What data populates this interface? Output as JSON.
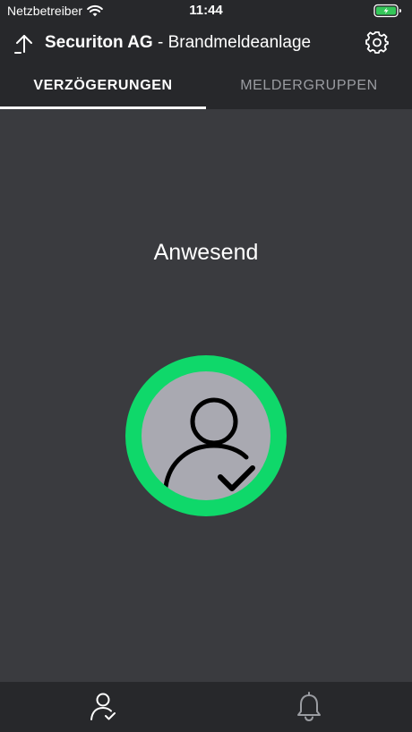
{
  "status_bar": {
    "carrier": "Netzbetreiber",
    "time": "11:44",
    "battery_color": "#34c759"
  },
  "navbar": {
    "company": "Securiton AG",
    "separator": " - ",
    "system": "Brandmeldeanlage",
    "up_icon": "arrow-up-icon",
    "settings_icon": "gear-icon"
  },
  "tabs": [
    {
      "label": "Verzögerungen",
      "active": true
    },
    {
      "label": "Meldergruppen",
      "active": false
    }
  ],
  "main": {
    "state_label": "Anwesend",
    "toggle_ring_color": "#0fd86a",
    "toggle_fill_color": "#a9a9b1",
    "toggle_icon": "person-check-icon"
  },
  "bottom_tabs": [
    {
      "icon": "person-check-icon",
      "active": true
    },
    {
      "icon": "bell-icon",
      "active": false
    }
  ],
  "colors": {
    "background": "#3a3b3f",
    "bars": "#27282b",
    "accent": "#0fd86a"
  }
}
